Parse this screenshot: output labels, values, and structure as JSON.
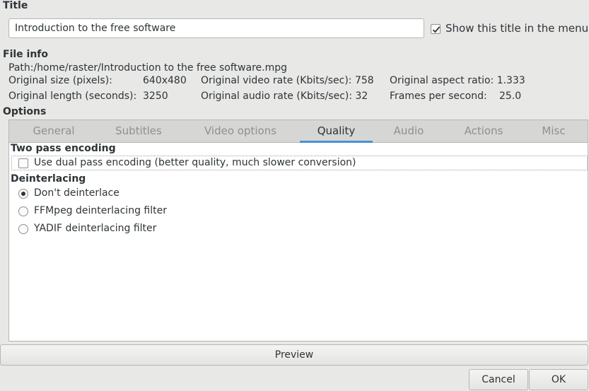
{
  "title_section": {
    "heading": "Title",
    "entry_value": "Introduction to the free software",
    "show_title_checkbox": {
      "label": "Show this title in the menu",
      "checked": true
    }
  },
  "file_info": {
    "heading": "File info",
    "path": "Path:/home/raster/Introduction to the free software.mpg",
    "original_size_label": "Original size (pixels):",
    "original_size_value": "640x480",
    "original_video_rate": "Original video rate (Kbits/sec): 758",
    "original_aspect_ratio": "Original aspect ratio: 1.333",
    "original_length_label": "Original length (seconds):",
    "original_length_value": "3250",
    "original_audio_rate": "Original audio rate (Kbits/sec): 32",
    "fps_label": "Frames per second:",
    "fps_value": "25.0"
  },
  "options": {
    "heading": "Options",
    "tabs": [
      "General",
      "Subtitles",
      "Video options",
      "Quality",
      "Audio",
      "Actions",
      "Misc"
    ],
    "active_tab": "Quality",
    "two_pass": {
      "heading": "Two pass encoding",
      "checkbox_label": "Use dual pass encoding (better quality, much slower conversion)",
      "checked": false
    },
    "deinterlacing": {
      "heading": "Deinterlacing",
      "options": [
        "Don't deinterlace",
        "FFMpeg deinterlacing filter",
        "YADIF deinterlacing filter"
      ],
      "selected": "Don't deinterlace"
    }
  },
  "buttons": {
    "preview": "Preview",
    "cancel": "Cancel",
    "ok": "OK"
  },
  "colors": {
    "accent": "#4a90d9",
    "background": "#e8e8e7"
  }
}
